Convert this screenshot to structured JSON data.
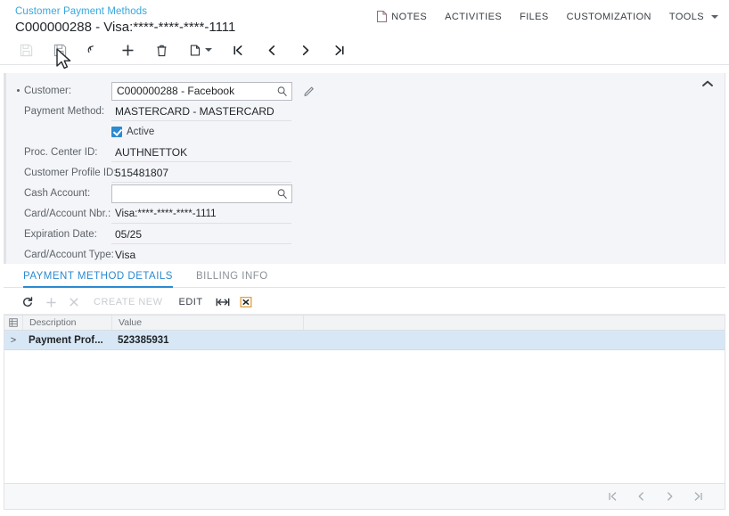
{
  "header": {
    "breadcrumb": "Customer Payment Methods",
    "doc_title": "C000000288 - Visa:****-****-****-1111",
    "actions": [
      {
        "label": "NOTES",
        "icon": "note-page-icon"
      },
      {
        "label": "ACTIVITIES",
        "icon": ""
      },
      {
        "label": "FILES",
        "icon": ""
      },
      {
        "label": "CUSTOMIZATION",
        "icon": ""
      },
      {
        "label": "TOOLS",
        "icon": "chevron-down-icon"
      }
    ]
  },
  "toolbar": {
    "save_label": "save-icon",
    "save_close_label": "save-and-close-icon",
    "undo_label": "undo-icon",
    "add_label": "add-icon",
    "delete_label": "delete-icon",
    "copy_label": "clipboard-icon",
    "first_label": "first-record-icon",
    "prev_label": "previous-record-icon",
    "next_label": "next-record-icon",
    "last_label": "last-record-icon"
  },
  "form": {
    "fields": [
      {
        "label": "Customer:",
        "value": "C000000288 - Facebook",
        "type": "lookup",
        "required": true
      },
      {
        "label": "Payment Method:",
        "value": "MASTERCARD - MASTERCARD",
        "type": "text",
        "required": false
      },
      {
        "label": "Proc. Center ID:",
        "value": "AUTHNETTOK",
        "type": "text",
        "required": false
      },
      {
        "label": "Customer Profile ID:",
        "value": "515481807",
        "type": "text",
        "required": false
      },
      {
        "label": "Cash Account:",
        "value": "",
        "type": "lookup-empty",
        "required": false
      },
      {
        "label": "Card/Account Nbr.:",
        "value": "Visa:****-****-****-1111",
        "type": "text",
        "required": false
      },
      {
        "label": "Expiration Date:",
        "value": "05/25",
        "type": "text",
        "required": false
      },
      {
        "label": "Card/Account Type:",
        "value": "Visa",
        "type": "text",
        "required": false
      }
    ],
    "active_checkbox": {
      "label": "Active",
      "checked": true
    }
  },
  "tabs": [
    {
      "label": "PAYMENT METHOD DETAILS",
      "active": true
    },
    {
      "label": "BILLING INFO",
      "active": false
    }
  ],
  "gridbar": {
    "refresh": "refresh-icon",
    "add": "add-row-icon",
    "remove": "remove-row-icon",
    "create_new": "CREATE NEW",
    "edit": "EDIT",
    "fit": "fit-columns-icon",
    "export": "export-excel-icon"
  },
  "grid": {
    "columns": [
      "Description",
      "Value"
    ],
    "rows": [
      {
        "indicator": ">",
        "Description": "Payment Prof...",
        "Value": "523385931"
      }
    ]
  },
  "footer": {
    "first": "first-page-icon",
    "prev": "previous-page-icon",
    "next": "next-page-icon",
    "last": "last-page-icon"
  },
  "colors": {
    "link": "#37a7dd",
    "accent": "#2b8ad1",
    "row_selected": "#d7e7f5",
    "panel_bg": "#f4f5f8",
    "excel_orange": "#e09b2d"
  }
}
